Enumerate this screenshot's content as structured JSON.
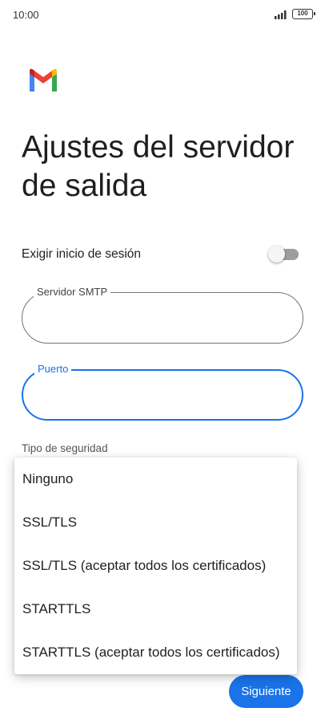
{
  "status_bar": {
    "time": "10:00",
    "battery": "100"
  },
  "icons": {
    "signal": "signal-bars-icon",
    "logo": "gmail-logo"
  },
  "colors": {
    "accent": "#1a73e8",
    "toggle_off": "#9e9e9e"
  },
  "page": {
    "title": "Ajustes del servidor de salida"
  },
  "login_toggle": {
    "label": "Exigir inicio de sesión",
    "enabled": false
  },
  "fields": {
    "smtp": {
      "label": "Servidor SMTP",
      "value": ""
    },
    "port": {
      "label": "Puerto",
      "value": ""
    }
  },
  "security": {
    "label": "Tipo de seguridad",
    "options": [
      "Ninguno",
      "SSL/TLS",
      "SSL/TLS (aceptar todos los certificados)",
      "STARTTLS",
      "STARTTLS (aceptar todos los certificados)"
    ]
  },
  "actions": {
    "next_label": "Siguiente"
  }
}
